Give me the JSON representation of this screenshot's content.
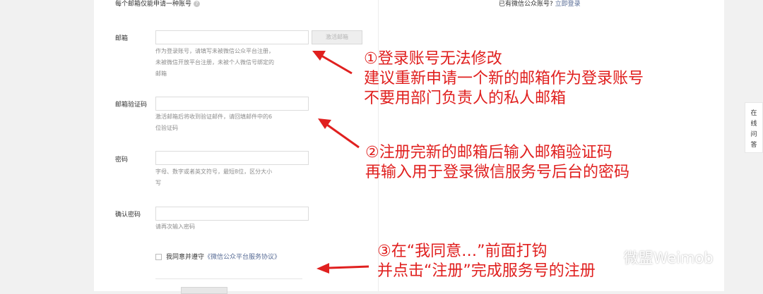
{
  "header": {
    "left_note": "每个邮箱仅能申请一种账号",
    "right_note": "已有微信公众账号?",
    "login_link": "立即登录"
  },
  "form": {
    "email": {
      "label": "邮箱",
      "activate_button": "激活邮箱",
      "hint": [
        "作为登录账号，请填写未被微信公众平台注册，",
        "未被微信开放平台注册，未被个人微信号绑定的",
        "邮箱"
      ]
    },
    "email_code": {
      "label": "邮箱验证码",
      "hint": [
        "激活邮箱后将收到验证邮件，请回填邮件中的6",
        "位验证码"
      ]
    },
    "password": {
      "label": "密码",
      "hint": [
        "字母、数字或者英文符号，最短8位，区分大小",
        "写"
      ]
    },
    "confirm_password": {
      "label": "确认密码",
      "hint": [
        "请再次输入密码"
      ]
    },
    "agreement": {
      "prefix": "我同意并遵守",
      "link": "《微信公众平台服务协议》"
    }
  },
  "side_tab": [
    "在",
    "线",
    "问",
    "答"
  ],
  "annotations": {
    "a1": [
      "①登录账号无法修改",
      "建议重新申请一个新的邮箱作为登录账号",
      "不要用部门负责人的私人邮箱"
    ],
    "a2": [
      "②注册完新的邮箱后输入邮箱验证码",
      "再输入用于登录微信服务号后台的密码"
    ],
    "a3": [
      "③在“我同意…”前面打钩",
      "并点击“注册”完成服务号的注册"
    ]
  },
  "watermark": "微盟Weimob",
  "colors": {
    "annotation": "#e0201f",
    "link": "#576b95"
  }
}
